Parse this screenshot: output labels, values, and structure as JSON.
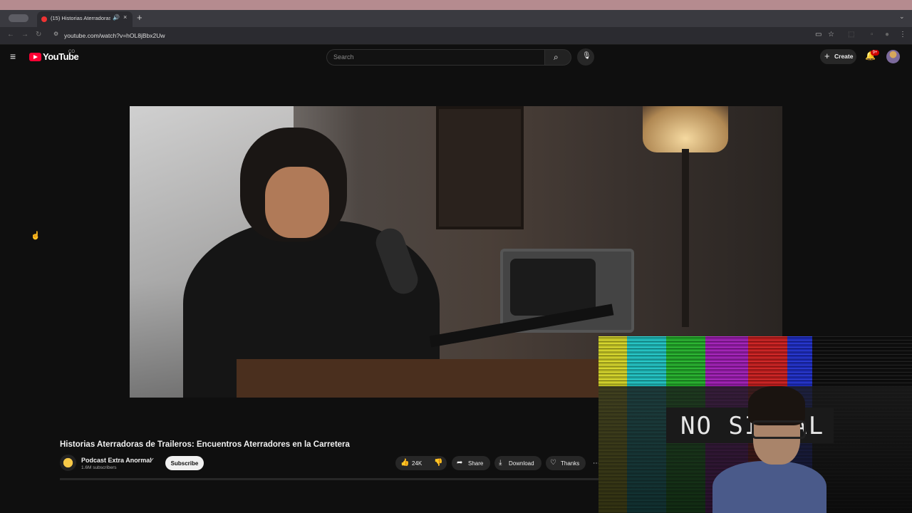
{
  "browser": {
    "tab": {
      "title": "(15) Historias Aterradoras",
      "audio_icon": "speaker-icon",
      "close_label": "×"
    },
    "new_tab_label": "+",
    "url": "youtube.com/watch?v=hOL8jBbx2Uw"
  },
  "header": {
    "logo_text": "YouTube",
    "logo_country": "CO",
    "search_placeholder": "Search",
    "create_label": "Create",
    "notifications_badge": "9+"
  },
  "video": {
    "title": "Historias Aterradoras de Traileros: Encuentros Aterradores en la Carretera",
    "channel_name": "Podcast Extra Anormal",
    "subscribers": "1.6M subscribers",
    "subscribe_label": "Subscribe",
    "likes": "24K",
    "share_label": "Share",
    "download_label": "Download",
    "thanks_label": "Thanks"
  },
  "overlay": {
    "text": "NO SIGNAL"
  },
  "colors": {
    "accent": "#ff0033",
    "background": "#0f0f0f",
    "menubar": "#b58b8f"
  }
}
